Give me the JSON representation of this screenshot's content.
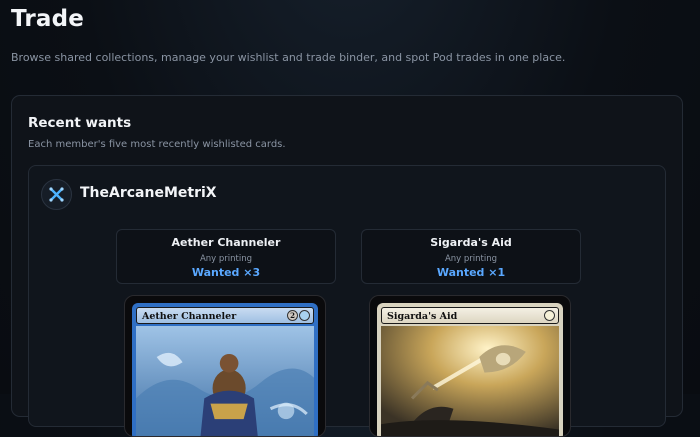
{
  "page": {
    "title": "Trade",
    "subtitle": "Browse shared collections, manage your wishlist and trade binder, and spot Pod trades in one place."
  },
  "recent_wants": {
    "title": "Recent wants",
    "subtitle": "Each member's five most recently wishlisted cards.",
    "member": {
      "name": "TheArcaneMetriX",
      "avatar_icon": "crossed-x-icon",
      "wants": [
        {
          "name": "Aether Channeler",
          "printing": "Any printing",
          "wanted": "Wanted ×3",
          "card_title": "Aether Channeler",
          "mana": [
            "2",
            "blue"
          ],
          "frame_color": "#2f6fc4"
        },
        {
          "name": "Sigarda's Aid",
          "printing": "Any printing",
          "wanted": "Wanted ×1",
          "card_title": "Sigarda's Aid",
          "mana": [
            "white"
          ],
          "frame_color": "#d9d3bf"
        }
      ]
    }
  },
  "colors": {
    "accent": "#5aa8ff",
    "background": "#0b0f15"
  }
}
